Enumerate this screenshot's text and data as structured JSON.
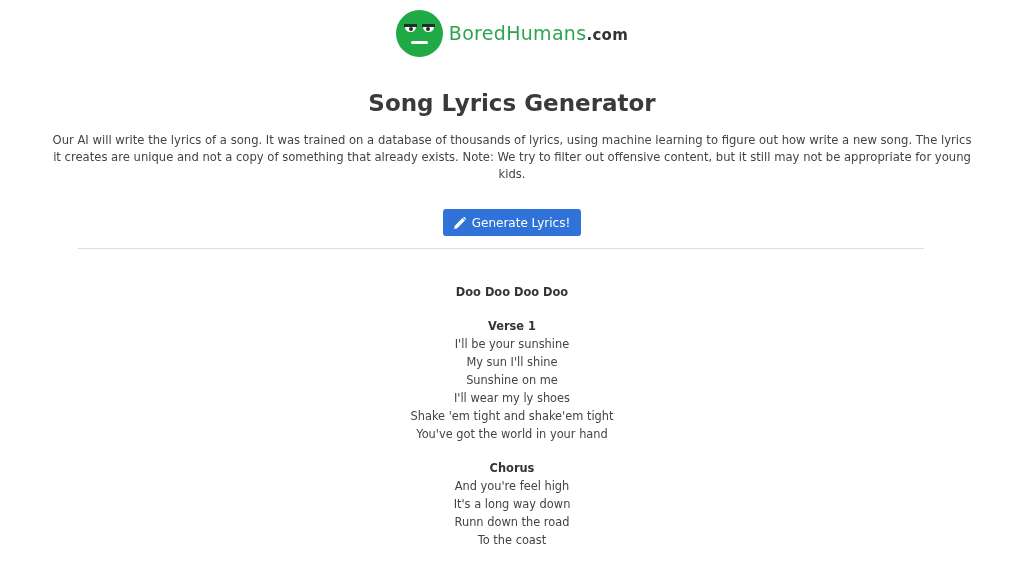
{
  "logo": {
    "brand": "BoredHumans",
    "domain": ".com"
  },
  "title": "Song Lyrics Generator",
  "description": "Our AI will write the lyrics of a song. It was trained on a database of thousands of lyrics, using machine learning to figure out how write a new song. The lyrics it creates are unique and not a copy of something that already exists. Note: We try to filter out offensive content, but it still may not be appropriate for young kids.",
  "button": {
    "label": "Generate Lyrics!"
  },
  "song": {
    "title": "Doo Doo Doo Doo",
    "sections": [
      {
        "heading": "Verse 1",
        "lines": [
          "I'll be your sunshine",
          "My sun I'll shine",
          "Sunshine on me",
          "I'll wear my ly shoes",
          "Shake 'em tight and shake'em tight",
          "You've got the world in your hand"
        ]
      },
      {
        "heading": "Chorus",
        "lines": [
          "And you're feel high",
          "It's a long way down",
          "Runn down the road",
          "To the coast"
        ]
      }
    ]
  }
}
